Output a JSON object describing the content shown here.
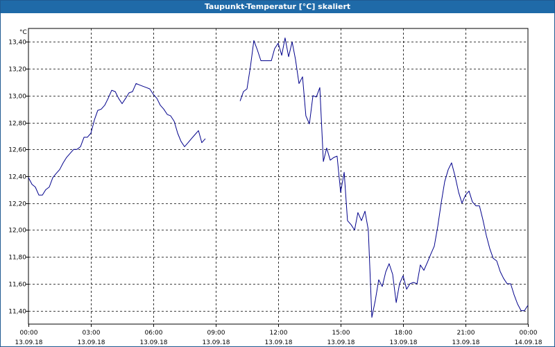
{
  "window": {
    "title": "Taupunkt-Temperatur [°C] skaliert"
  },
  "chart_data": {
    "type": "line",
    "title": "Taupunkt-Temperatur [°C] skaliert",
    "ylabel": "°C",
    "xlabel": "",
    "ylim": [
      11.3,
      13.5
    ],
    "xlim": [
      0,
      24
    ],
    "grid": true,
    "line_color": "#00008b",
    "y_ticks": [
      "11,40",
      "11,60",
      "11,80",
      "12,00",
      "12,20",
      "12,40",
      "12,60",
      "12,80",
      "13,00",
      "13,20",
      "13,40"
    ],
    "y_tick_values": [
      11.4,
      11.6,
      11.8,
      12.0,
      12.2,
      12.4,
      12.6,
      12.8,
      13.0,
      13.2,
      13.4
    ],
    "x_ticks": [
      {
        "time": "00:00",
        "date": "13.09.18"
      },
      {
        "time": "03:00",
        "date": "13.09.18"
      },
      {
        "time": "06:00",
        "date": "13.09.18"
      },
      {
        "time": "09:00",
        "date": "13.09.18"
      },
      {
        "time": "12:00",
        "date": "13.09.18"
      },
      {
        "time": "15:00",
        "date": "13.09.18"
      },
      {
        "time": "18:00",
        "date": "13.09.18"
      },
      {
        "time": "21:00",
        "date": "13.09.18"
      },
      {
        "time": "00:00",
        "date": "14.09.18"
      }
    ],
    "series": [
      {
        "segments": [
          [
            [
              0.0,
              12.39
            ],
            [
              0.17,
              12.34
            ],
            [
              0.33,
              12.32
            ],
            [
              0.5,
              12.26
            ],
            [
              0.67,
              12.26
            ],
            [
              0.83,
              12.3
            ],
            [
              1.0,
              12.32
            ],
            [
              1.17,
              12.39
            ],
            [
              1.33,
              12.42
            ],
            [
              1.5,
              12.45
            ],
            [
              1.67,
              12.5
            ],
            [
              1.83,
              12.54
            ],
            [
              2.0,
              12.57
            ],
            [
              2.17,
              12.6
            ],
            [
              2.33,
              12.6
            ],
            [
              2.5,
              12.62
            ],
            [
              2.67,
              12.69
            ],
            [
              2.83,
              12.69
            ],
            [
              3.0,
              12.72
            ],
            [
              3.17,
              12.82
            ],
            [
              3.33,
              12.89
            ],
            [
              3.5,
              12.9
            ],
            [
              3.67,
              12.93
            ],
            [
              3.83,
              12.98
            ],
            [
              4.0,
              13.04
            ],
            [
              4.17,
              13.03
            ],
            [
              4.33,
              12.98
            ],
            [
              4.5,
              12.94
            ],
            [
              4.67,
              12.98
            ],
            [
              4.83,
              13.02
            ],
            [
              5.0,
              13.03
            ],
            [
              5.17,
              13.09
            ],
            [
              5.33,
              13.08
            ],
            [
              5.5,
              13.07
            ],
            [
              5.67,
              13.06
            ],
            [
              5.83,
              13.05
            ],
            [
              6.0,
              13.01
            ],
            [
              6.17,
              12.98
            ],
            [
              6.33,
              12.93
            ],
            [
              6.5,
              12.9
            ],
            [
              6.67,
              12.86
            ],
            [
              6.83,
              12.85
            ],
            [
              7.0,
              12.81
            ],
            [
              7.17,
              12.72
            ],
            [
              7.33,
              12.66
            ],
            [
              7.5,
              12.62
            ],
            [
              7.67,
              12.65
            ],
            [
              7.83,
              12.68
            ],
            [
              8.0,
              12.71
            ],
            [
              8.17,
              12.74
            ],
            [
              8.33,
              12.65
            ],
            [
              8.5,
              12.68
            ]
          ],
          [
            [
              10.17,
              12.96
            ],
            [
              10.33,
              13.03
            ],
            [
              10.5,
              13.05
            ],
            [
              10.67,
              13.22
            ],
            [
              10.83,
              13.41
            ],
            [
              11.0,
              13.34
            ],
            [
              11.17,
              13.26
            ],
            [
              11.33,
              13.26
            ],
            [
              11.5,
              13.26
            ],
            [
              11.67,
              13.26
            ],
            [
              11.83,
              13.35
            ],
            [
              12.0,
              13.39
            ],
            [
              12.17,
              13.3
            ],
            [
              12.33,
              13.43
            ],
            [
              12.5,
              13.29
            ],
            [
              12.67,
              13.4
            ],
            [
              12.83,
              13.27
            ],
            [
              13.0,
              13.09
            ],
            [
              13.17,
              13.14
            ],
            [
              13.33,
              12.85
            ],
            [
              13.5,
              12.79
            ],
            [
              13.67,
              13.0
            ],
            [
              13.83,
              12.99
            ],
            [
              14.0,
              13.06
            ],
            [
              14.17,
              12.51
            ],
            [
              14.33,
              12.61
            ],
            [
              14.5,
              12.52
            ],
            [
              14.67,
              12.54
            ],
            [
              14.83,
              12.55
            ],
            [
              15.0,
              12.28
            ],
            [
              15.17,
              12.43
            ],
            [
              15.33,
              12.07
            ],
            [
              15.5,
              12.04
            ],
            [
              15.67,
              12.0
            ],
            [
              15.83,
              12.13
            ],
            [
              16.0,
              12.07
            ],
            [
              16.17,
              12.14
            ],
            [
              16.33,
              12.0
            ],
            [
              16.5,
              11.35
            ],
            [
              16.67,
              11.48
            ],
            [
              16.83,
              11.63
            ],
            [
              17.0,
              11.58
            ],
            [
              17.17,
              11.69
            ],
            [
              17.33,
              11.75
            ],
            [
              17.5,
              11.67
            ],
            [
              17.67,
              11.46
            ],
            [
              17.83,
              11.6
            ],
            [
              18.0,
              11.66
            ],
            [
              18.17,
              11.56
            ],
            [
              18.33,
              11.6
            ],
            [
              18.5,
              11.61
            ],
            [
              18.67,
              11.6
            ],
            [
              18.83,
              11.74
            ],
            [
              19.0,
              11.7
            ],
            [
              19.17,
              11.76
            ],
            [
              19.33,
              11.82
            ],
            [
              19.5,
              11.88
            ],
            [
              19.67,
              12.03
            ],
            [
              19.83,
              12.2
            ],
            [
              20.0,
              12.36
            ],
            [
              20.17,
              12.45
            ],
            [
              20.33,
              12.5
            ],
            [
              20.5,
              12.4
            ],
            [
              20.67,
              12.28
            ],
            [
              20.83,
              12.2
            ],
            [
              21.0,
              12.26
            ],
            [
              21.17,
              12.29
            ],
            [
              21.33,
              12.21
            ],
            [
              21.5,
              12.18
            ],
            [
              21.67,
              12.18
            ],
            [
              21.83,
              12.08
            ],
            [
              22.0,
              11.96
            ],
            [
              22.17,
              11.86
            ],
            [
              22.33,
              11.79
            ],
            [
              22.5,
              11.77
            ],
            [
              22.67,
              11.69
            ],
            [
              22.83,
              11.64
            ],
            [
              23.0,
              11.6
            ],
            [
              23.17,
              11.6
            ],
            [
              23.33,
              11.52
            ],
            [
              23.5,
              11.45
            ],
            [
              23.67,
              11.4
            ],
            [
              23.83,
              11.4
            ],
            [
              24.0,
              11.44
            ]
          ]
        ]
      }
    ]
  }
}
